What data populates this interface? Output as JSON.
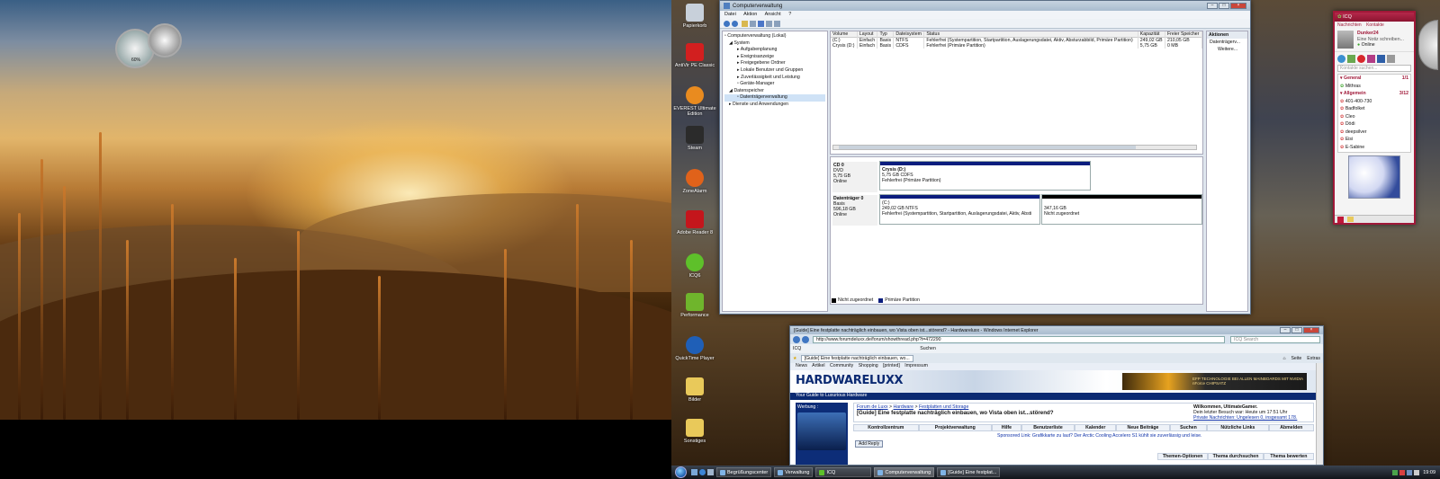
{
  "left_desktop": {
    "gadget_speed": "60%"
  },
  "desktop_icons": [
    {
      "label": "Papierkorb",
      "color": "#c8d0da"
    },
    {
      "label": "AntiVir PE Classic",
      "color": "#d21f1f"
    },
    {
      "label": "EVEREST Ultimate Edition",
      "color": "#e98b1f"
    },
    {
      "label": "Steam",
      "color": "#2b2b2b"
    },
    {
      "label": "ZoneAlarm",
      "color": "#e0621a"
    },
    {
      "label": "Adobe Reader 8",
      "color": "#c4161c"
    },
    {
      "label": "ICQ6",
      "color": "#5ec02a"
    },
    {
      "label": "Performance",
      "color": "#6fb52c"
    },
    {
      "label": "QuickTime Player",
      "color": "#1f5fb7"
    },
    {
      "label": "Bilder",
      "color": "#e9c95a"
    },
    {
      "label": "Sonstiges",
      "color": "#e9c95a"
    }
  ],
  "cm": {
    "title": "Computerverwaltung",
    "menu": [
      "Datei",
      "Aktion",
      "Ansicht",
      "?"
    ],
    "tree": [
      {
        "label": "Computerverwaltung (Lokal)",
        "level": 0
      },
      {
        "label": "System",
        "level": 1
      },
      {
        "label": "Aufgabenplanung",
        "level": 2
      },
      {
        "label": "Ereignisanzeige",
        "level": 2
      },
      {
        "label": "Freigegebene Ordner",
        "level": 2
      },
      {
        "label": "Lokale Benutzer und Gruppen",
        "level": 2
      },
      {
        "label": "Zuverlässigkeit und Leistung",
        "level": 2
      },
      {
        "label": "Geräte-Manager",
        "level": 2
      },
      {
        "label": "Datenspeicher",
        "level": 1
      },
      {
        "label": "Datenträgerverwaltung",
        "level": 2
      },
      {
        "label": "Dienste und Anwendungen",
        "level": 1
      }
    ],
    "columns": [
      "Volume",
      "Layout",
      "Typ",
      "Dateisystem",
      "Status",
      "Kapazität",
      "Freier Speicher"
    ],
    "rows": [
      [
        "(C:)",
        "Einfach",
        "Basis",
        "NTFS",
        "Fehlerfrei (Systempartition, Startpartition, Auslagerungsdatei, Aktiv, Absturzabbild, Primäre Partition)",
        "249,02 GB",
        "210,05 GB"
      ],
      [
        "Crysis (D:)",
        "Einfach",
        "Basis",
        "CDFS",
        "Fehlerfrei (Primäre Partition)",
        "5,75 GB",
        "0 MB"
      ]
    ],
    "actions_title": "Aktionen",
    "actions": [
      "Datenträgerv...",
      "Weitere..."
    ],
    "cd": {
      "name": "CD 0",
      "type": "DVD",
      "size": "5,75 GB",
      "state": "Online",
      "vol": "Crysis (D:)",
      "vol_size": "5,75 GB CDFS",
      "vol_status": "Fehlerfrei (Primäre Partition)"
    },
    "disk0": {
      "name": "Datenträger 0",
      "type": "Basis",
      "size": "596,18 GB",
      "state": "Online",
      "vol": "(C:)",
      "vol_size": "249,02 GB NTFS",
      "vol_status": "Fehlerfrei (Systempartition, Startpartition, Auslagerungsdatei, Aktiv, Absti",
      "unalloc_size": "347,16 GB",
      "unalloc_label": "Nicht zugeordnet"
    },
    "legend": [
      "Nicht zugeordnet",
      "Primäre Partition"
    ]
  },
  "ie": {
    "title": "[Guide] Eine festplatte nachträglich einbauen, wo Vista oben ist...störend? - Hardwareluxx - Windows Internet Explorer",
    "url": "http://www.forumdeluxx.de/forum/showthread.php?t=472290",
    "search_placeholder": "ICQ Search",
    "tab_label": "[Guide] Eine festplatte nachträglich einbauen, wo...",
    "toolbar_search": "Suchen",
    "icq_label": "ICQ",
    "seite": "Seite",
    "extras": "Extras",
    "nav": [
      "News",
      "Artikel",
      "Community",
      "Shopping",
      "[printed]",
      "Impressum"
    ],
    "logo": "HARDWARELUXX",
    "tagline": "Your Guide to Luxurious Hardware",
    "ad_text": "EFP TECHNOLOGIE BEI ALLEN MAINBOARDS MIT NVIDIA nForce CHIPSATZ",
    "werbung": "Werbung :",
    "breadcrumb": [
      "Forum de Luxx",
      "Hardware",
      "Festplatten und Storage"
    ],
    "thread_title": "[Guide] Eine festplatte nachträglich einbauen, wo Vista oben ist...störend?",
    "welcome": "Willkommen, UltimateGamer.",
    "welcome_line2": "Dein letzter Besuch war: Heute um 17:51 Uhr",
    "welcome_line3": "Private Nachrichten: Ungelesen 0, insgesamt 178.",
    "forum_nav": [
      "Kontrollzentrum",
      "Projektverwaltung",
      "Hilfe",
      "Benutzerliste",
      "Kalender",
      "Neue Beiträge",
      "Suchen",
      "Nützliche Links",
      "Abmelden"
    ],
    "add_reply": "Add Reply",
    "sponsored": "Sponsored Link: Grafikkarte zu laut? Der Arctic Cooling Accelero S1 kühlt sie zuverlässig und leise.",
    "thread_tools": [
      "Themen-Optionen",
      "Thema durchsuchen",
      "Thema bewerten"
    ]
  },
  "icq": {
    "title": "ICQ",
    "tabs": [
      "Nachrichten",
      "Kontakte"
    ],
    "user": "Dunker24",
    "status_msg": "Eine Notiz schreiben...",
    "online": "Online",
    "search": "Kontakte suchen...",
    "groups": [
      {
        "name": "General",
        "count": "1/1",
        "contacts": [
          "Mithras"
        ]
      },
      {
        "name": "Allgemein",
        "count": "3/12",
        "contacts": [
          "401-400-730",
          "Badfolket",
          "Cleo",
          "Dödi",
          "deepsilver",
          "Eisi",
          "E-Sabine"
        ]
      }
    ]
  },
  "taskbar": {
    "items": [
      "Begrüßungscenter",
      "Verwaltung",
      "ICQ",
      "Computerverwaltung",
      "[Guide] Eine festplat..."
    ],
    "clock": "19:09"
  }
}
